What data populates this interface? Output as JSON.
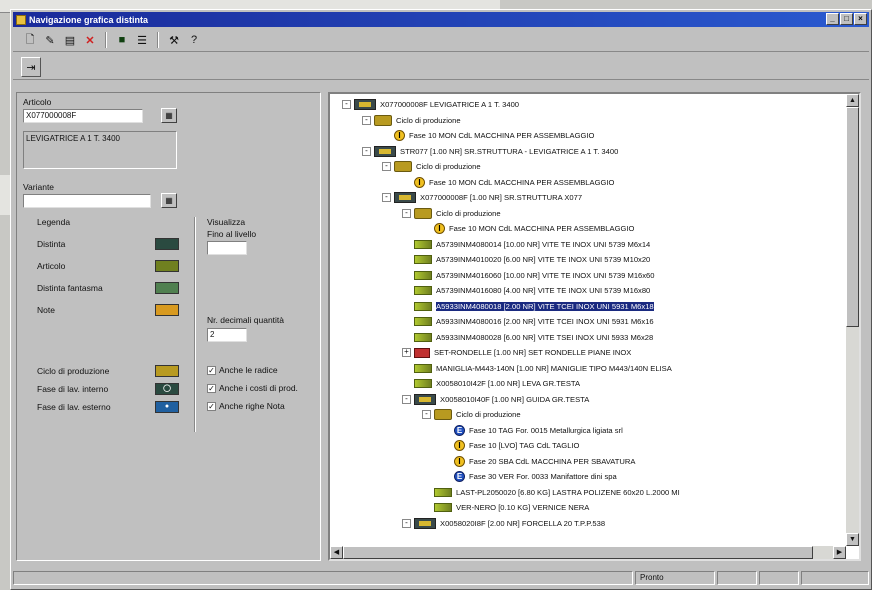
{
  "window": {
    "title": "Navigazione grafica distinta"
  },
  "panel": {
    "articolo_label": "Articolo",
    "articolo_value": "X077000008F",
    "articolo_desc": "LEVIGATRICE A 1 T. 3400",
    "variante_label": "Variante",
    "variante_value": "",
    "legenda_label": "Legenda",
    "legend": [
      {
        "label": "Distinta",
        "color": "#2a4a40",
        "icon": "distinta-icon"
      },
      {
        "label": "Articolo",
        "color": "#708020",
        "icon": "articolo-icon"
      },
      {
        "label": "Distinta fantasma",
        "color": "#508050",
        "icon": "distinta-fantasma-icon"
      },
      {
        "label": "Note",
        "color": "#d89a20",
        "icon": "note-icon"
      },
      {
        "label": "Ciclo di produzione",
        "color": "#b89a20",
        "icon": "ciclo-icon"
      },
      {
        "label": "Fase di lav. interno",
        "color": "#2a4a40",
        "icon": "fase-interno-icon"
      },
      {
        "label": "Fase di lav. esterno",
        "color": "#2060a0",
        "icon": "fase-esterno-icon"
      }
    ],
    "visualizza_label": "Visualizza",
    "fino_label": "Fino al livello",
    "fino_value": "",
    "decimali_label": "Nr. decimali quantità",
    "decimali_value": "2",
    "checks": [
      {
        "label": "Anche le radice",
        "checked": true
      },
      {
        "label": "Anche i costi di prod.",
        "checked": true
      },
      {
        "label": "Anche righe Nota",
        "checked": true
      }
    ]
  },
  "tree": [
    {
      "text": "X077000008F LEVIGATRICE A 1 T. 3400",
      "icon": "dist",
      "level": 0,
      "toggle": "-"
    },
    {
      "text": "Ciclo di produzione",
      "icon": "ciclo",
      "level": 1,
      "toggle": "-"
    },
    {
      "text": "Fase 10 MON CdL MACCHINA PER ASSEMBLAGGIO",
      "icon": "fasei",
      "level": 2,
      "toggle": ""
    },
    {
      "text": "STR077 [1.00 NR] SR.STRUTTURA - LEVIGATRICE A 1 T. 3400",
      "icon": "dist",
      "level": 1,
      "toggle": "-"
    },
    {
      "text": "Ciclo di produzione",
      "icon": "ciclo",
      "level": 2,
      "toggle": "-"
    },
    {
      "text": "Fase 10 MON CdL MACCHINA PER ASSEMBLAGGIO",
      "icon": "fasei",
      "level": 3,
      "toggle": ""
    },
    {
      "text": "X077000008F [1.00 NR] SR.STRUTTURA X077",
      "icon": "dist",
      "level": 2,
      "toggle": "-"
    },
    {
      "text": "Ciclo di produzione",
      "icon": "ciclo",
      "level": 3,
      "toggle": "-"
    },
    {
      "text": "Fase 10 MON CdL MACCHINA PER ASSEMBLAGGIO",
      "icon": "fasei",
      "level": 4,
      "toggle": ""
    },
    {
      "text": "A5739INM4080014 [10.00 NR] VITE TE INOX UNI 5739 M6x14",
      "icon": "art",
      "level": 3,
      "toggle": ""
    },
    {
      "text": "A5739INM4010020 [6.00 NR] VITE TE INOX UNI 5739 M10x20",
      "icon": "art",
      "level": 3,
      "toggle": ""
    },
    {
      "text": "A5739INM4016060 [10.00 NR] VITE TE INOX UNI 5739 M16x60",
      "icon": "art",
      "level": 3,
      "toggle": ""
    },
    {
      "text": "A5739INM4016080 [4.00 NR] VITE TE INOX UNI 5739 M16x80",
      "icon": "art",
      "level": 3,
      "toggle": ""
    },
    {
      "text": "A5933INM4080018 [2.00 NR] VITE TCEI INOX UNI 5931 M6x18",
      "icon": "art",
      "level": 3,
      "toggle": "",
      "selected": true
    },
    {
      "text": "A5933INM4080016 [2.00 NR] VITE TCEI INOX UNI 5931 M6x16",
      "icon": "art",
      "level": 3,
      "toggle": ""
    },
    {
      "text": "A5933INM4080028 [6.00 NR] VITE TSEI INOX UNI 5933 M6x28",
      "icon": "art",
      "level": 3,
      "toggle": ""
    },
    {
      "text": "SET-RONDELLE [1.00 NR] SET RONDELLE PIANE INOX",
      "icon": "sub",
      "level": 3,
      "toggle": "+"
    },
    {
      "text": "MANIGLIA-M443-140N [1.00 NR] MANIGLIE TIPO M443/140N ELISA",
      "icon": "art",
      "level": 3,
      "toggle": ""
    },
    {
      "text": "X0058010I42F [1.00 NR] LEVA GR.TESTA",
      "icon": "art",
      "level": 3,
      "toggle": ""
    },
    {
      "text": "X0058010I40F [1.00 NR] GUIDA GR.TESTA",
      "icon": "dist",
      "level": 3,
      "toggle": "-"
    },
    {
      "text": "Ciclo di produzione",
      "icon": "ciclo",
      "level": 4,
      "toggle": "-"
    },
    {
      "text": "Fase 10 TAG For. 0015 Metallurgica ligiata srl",
      "icon": "fasee",
      "level": 5,
      "toggle": ""
    },
    {
      "text": "Fase 10 [LVO] TAG CdL TAGLIO",
      "icon": "fasei",
      "level": 5,
      "toggle": ""
    },
    {
      "text": "Fase 20 SBA CdL MACCHINA PER SBAVATURA",
      "icon": "fasei",
      "level": 5,
      "toggle": ""
    },
    {
      "text": "Fase 30 VER For. 0033 Manifattore dini spa",
      "icon": "fasee",
      "level": 5,
      "toggle": ""
    },
    {
      "text": "LAST-PL2050020 [6.80 KG] LASTRA POLIZENE 60x20 L.2000 MI",
      "icon": "art",
      "level": 4,
      "toggle": ""
    },
    {
      "text": "VER-NERO [0.10 KG] VERNICE NERA",
      "icon": "art",
      "level": 4,
      "toggle": ""
    },
    {
      "text": "X0058020I8F [2.00 NR] FORCELLA 20 T.P.P.538",
      "icon": "dist",
      "level": 3,
      "toggle": "-"
    }
  ],
  "status": {
    "text": "Pronto"
  }
}
